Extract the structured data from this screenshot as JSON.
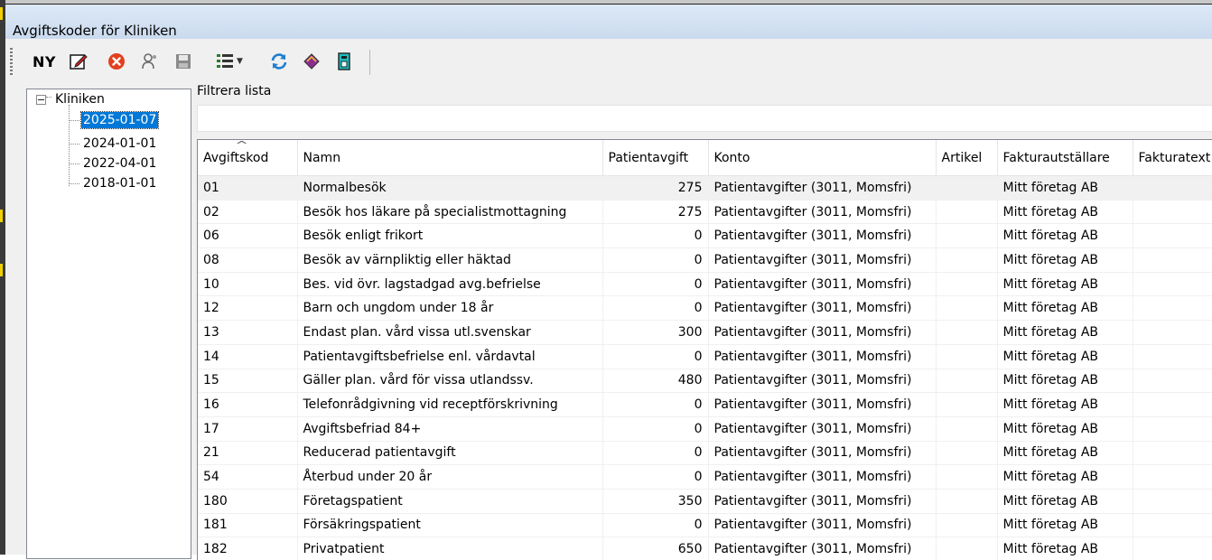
{
  "window": {
    "title": "Avgiftskoder för Kliniken"
  },
  "toolbar": {
    "new_label": "NY",
    "buttons": [
      {
        "name": "edit-icon"
      },
      {
        "name": "delete-icon"
      },
      {
        "name": "user-settings-icon"
      },
      {
        "name": "save-icon"
      },
      {
        "name": "list-view-icon"
      },
      {
        "name": "refresh-icon"
      },
      {
        "name": "book-icon"
      },
      {
        "name": "export-icon"
      }
    ]
  },
  "tree": {
    "root": "Kliniken",
    "children": [
      "2025-01-07",
      "2024-01-01",
      "2022-04-01",
      "2018-01-01"
    ],
    "selected_index": 0
  },
  "filter": {
    "label": "Filtrera lista",
    "value": ""
  },
  "grid": {
    "columns": [
      "Avgiftskod",
      "Namn",
      "Patientavgift",
      "Konto",
      "Artikel",
      "Fakturautställare",
      "Fakturatext"
    ],
    "rows": [
      [
        "01",
        "Normalbesök",
        "275",
        "Patientavgifter (3011, Momsfri)",
        "",
        "Mitt företag AB",
        ""
      ],
      [
        "02",
        "Besök hos läkare på specialistmottagning",
        "275",
        "Patientavgifter (3011, Momsfri)",
        "",
        "Mitt företag AB",
        ""
      ],
      [
        "06",
        "Besök enligt frikort",
        "0",
        "Patientavgifter (3011, Momsfri)",
        "",
        "Mitt företag AB",
        ""
      ],
      [
        "08",
        "Besök av värnpliktig eller häktad",
        "0",
        "Patientavgifter (3011, Momsfri)",
        "",
        "Mitt företag AB",
        ""
      ],
      [
        "10",
        "Bes. vid övr. lagstadgad avg.befrielse",
        "0",
        "Patientavgifter (3011, Momsfri)",
        "",
        "Mitt företag AB",
        ""
      ],
      [
        "12",
        "Barn och ungdom under 18 år",
        "0",
        "Patientavgifter (3011, Momsfri)",
        "",
        "Mitt företag AB",
        ""
      ],
      [
        "13",
        "Endast plan. vård vissa utl.svenskar",
        "300",
        "Patientavgifter (3011, Momsfri)",
        "",
        "Mitt företag AB",
        ""
      ],
      [
        "14",
        "Patientavgiftsbefrielse enl. vårdavtal",
        "0",
        "Patientavgifter (3011, Momsfri)",
        "",
        "Mitt företag AB",
        ""
      ],
      [
        "15",
        "Gäller plan. vård för vissa utlandssv.",
        "480",
        "Patientavgifter (3011, Momsfri)",
        "",
        "Mitt företag AB",
        ""
      ],
      [
        "16",
        "Telefonrådgivning vid receptförskrivning",
        "0",
        "Patientavgifter (3011, Momsfri)",
        "",
        "Mitt företag AB",
        ""
      ],
      [
        "17",
        "Avgiftsbefriad 84+",
        "0",
        "Patientavgifter (3011, Momsfri)",
        "",
        "Mitt företag AB",
        ""
      ],
      [
        "21",
        "Reducerad patientavgift",
        "0",
        "Patientavgifter (3011, Momsfri)",
        "",
        "Mitt företag AB",
        ""
      ],
      [
        "54",
        "Återbud under 20 år",
        "0",
        "Patientavgifter (3011, Momsfri)",
        "",
        "Mitt företag AB",
        ""
      ],
      [
        "180",
        "Företagspatient",
        "350",
        "Patientavgifter (3011, Momsfri)",
        "",
        "Mitt företag AB",
        ""
      ],
      [
        "181",
        "Försäkringspatient",
        "0",
        "Patientavgifter (3011, Momsfri)",
        "",
        "Mitt företag AB",
        ""
      ],
      [
        "182",
        "Privatpatient",
        "650",
        "Patientavgifter (3011, Momsfri)",
        "",
        "Mitt företag AB",
        ""
      ]
    ]
  }
}
